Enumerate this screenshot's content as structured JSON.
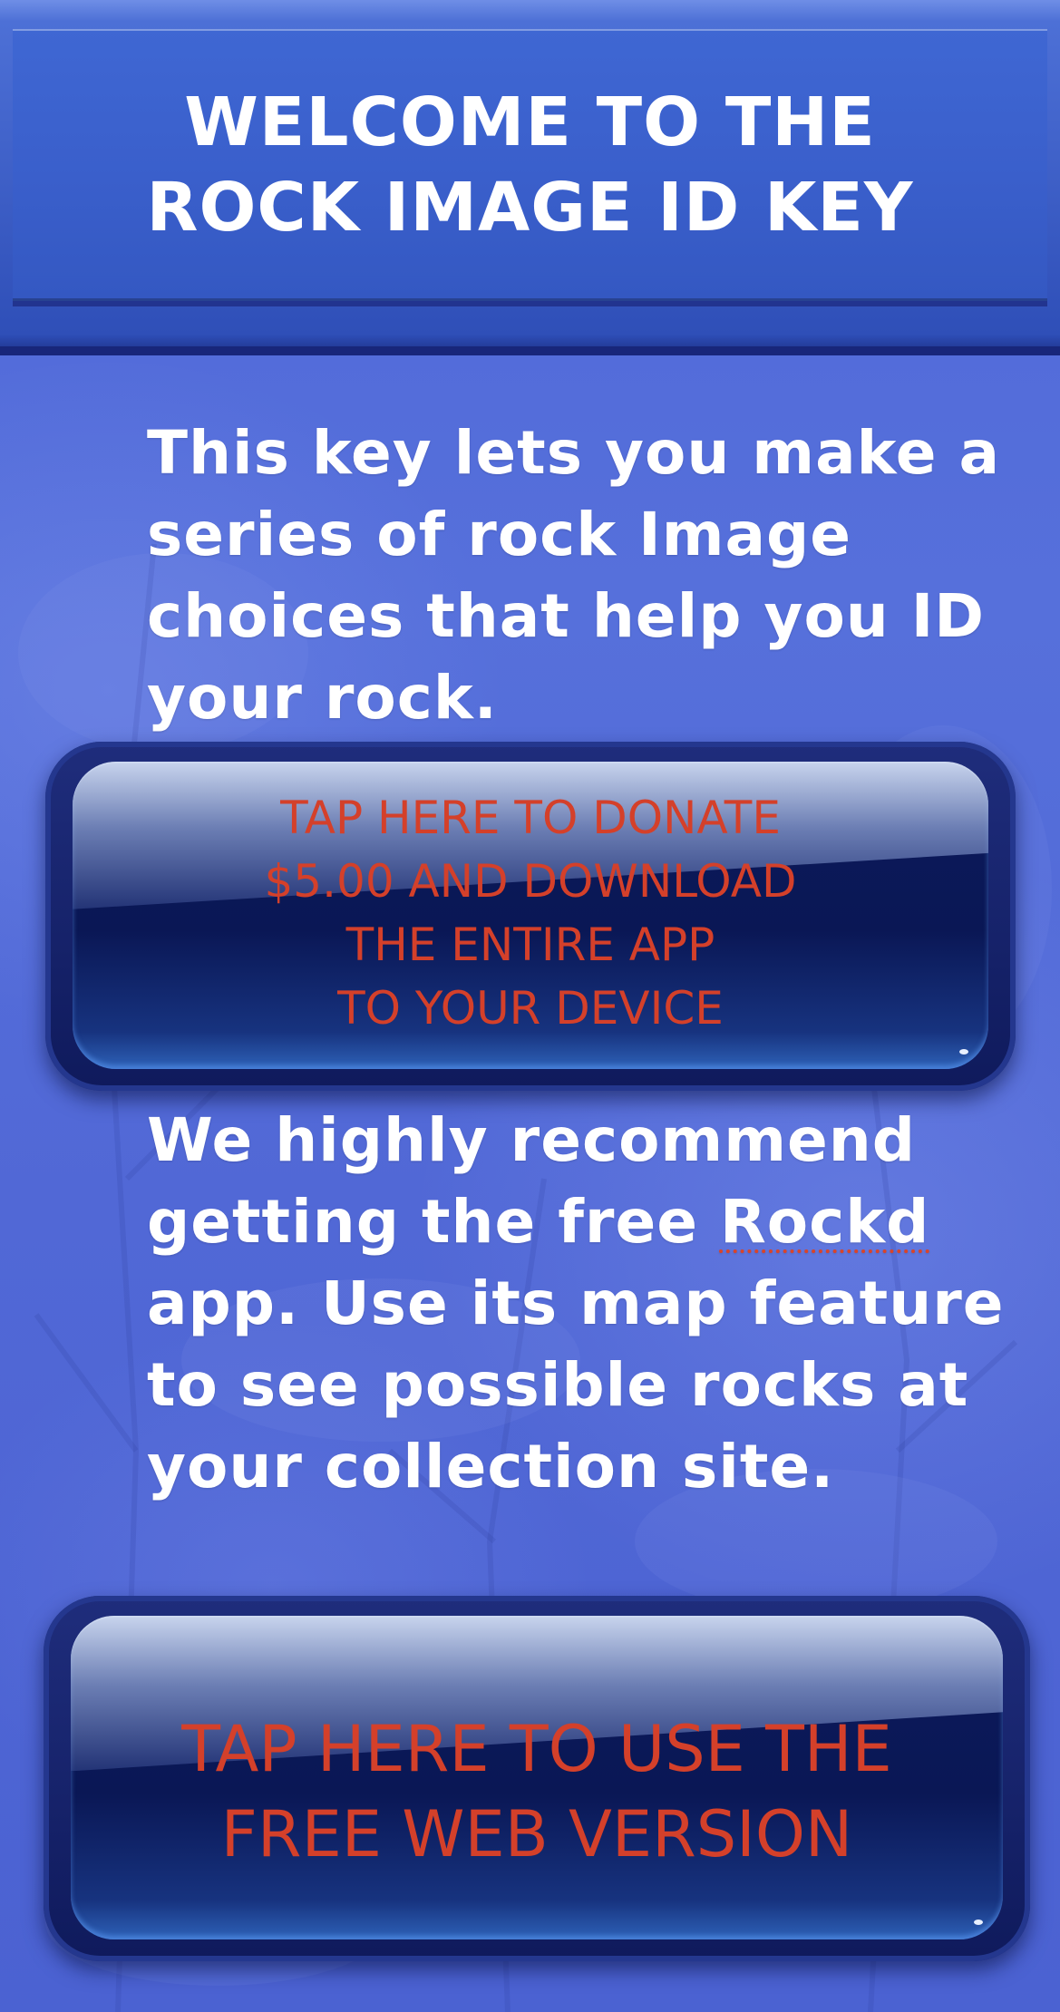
{
  "header": {
    "title": "WELCOME TO THE\nROCK IMAGE ID KEY"
  },
  "intro": {
    "text": "This key lets you make a series of  rock Image choices that help you ID your rock."
  },
  "donate_button": {
    "label": "TAP HERE TO DONATE\n$5.00 AND DOWNLOAD\nTHE ENTIRE APP\nTO YOUR DEVICE"
  },
  "recommendation": {
    "text_before_link": "We highly recommend getting the  free ",
    "link_text": "Rockd",
    "text_after_link": " app. Use its map feature to see possible rocks at your collection  site."
  },
  "web_button": {
    "label": "TAP HERE TO USE THE\nFREE WEB VERSION"
  },
  "colors": {
    "background": "#5168d6",
    "header": "#3a5fcb",
    "button_face": "#0c1a5c",
    "button_text": "#d4402a",
    "body_text": "#ffffff"
  }
}
